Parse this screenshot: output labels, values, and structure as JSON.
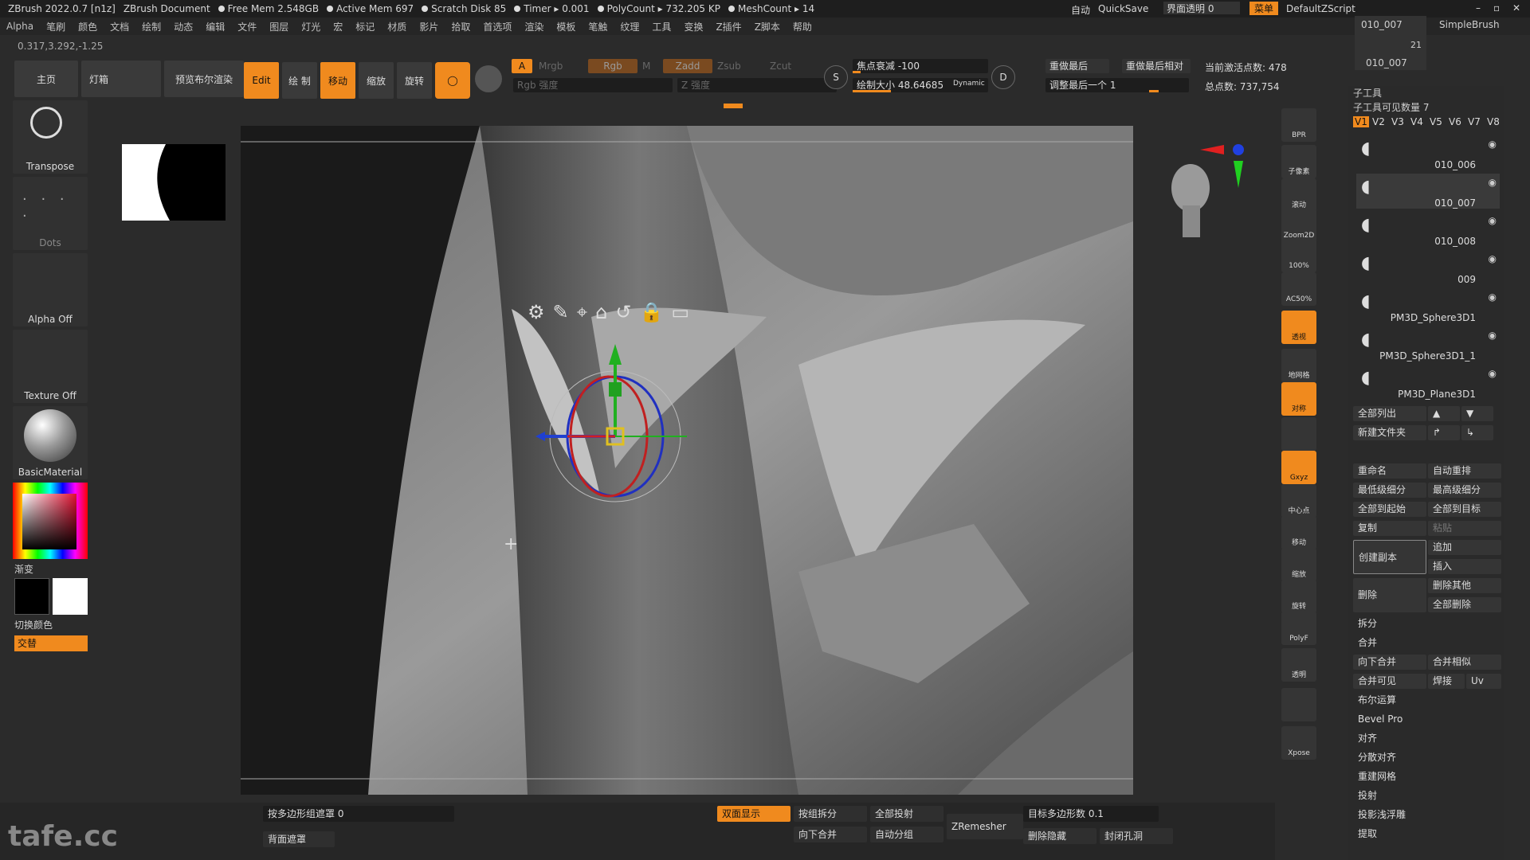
{
  "titlebar": {
    "app": "ZBrush 2022.0.7 [n1z]",
    "document": "ZBrush Document",
    "free_mem": "Free Mem 2.548GB",
    "active_mem": "Active Mem 697",
    "scratch_disk": "Scratch Disk 85",
    "timer": "Timer ▸ 0.001",
    "polycount": "PolyCount ▸ 732.205 KP",
    "meshcount": "MeshCount ▸ 14",
    "auto": "自动",
    "quicksave": "QuickSave",
    "ui_transparency": "界面透明 0",
    "menu_label": "菜单",
    "script": "DefaultZScript"
  },
  "menubar": [
    "Alpha",
    "笔刷",
    "颜色",
    "文档",
    "绘制",
    "动态",
    "编辑",
    "文件",
    "图层",
    "灯光",
    "宏",
    "标记",
    "材质",
    "影片",
    "拾取",
    "首选项",
    "渲染",
    "模板",
    "笔触",
    "纹理",
    "工具",
    "变换",
    "Z插件",
    "Z脚本",
    "帮助"
  ],
  "coords": "0.317,3.292,-1.25",
  "toolbar": {
    "home": "主页",
    "lightbox": "灯箱",
    "preview_bool": "预览布尔渲染",
    "edit": "Edit",
    "draw": "绘 制",
    "move": "移动",
    "scale": "缩放",
    "rotate": "旋转",
    "a_label": "A",
    "mrgb": "Mrgb",
    "rgb": "Rgb",
    "m": "M",
    "zadd": "Zadd",
    "zsub": "Zsub",
    "zcut": "Zcut",
    "rgb_intensity": "Rgb 强度",
    "z_intensity": "Z 强度",
    "focal_shift": "焦点衰减 -100",
    "draw_size": "绘制大小 48.64685",
    "dynamic": "Dynamic",
    "replay_last": "重做最后",
    "replay_last_rel": "重做最后相对",
    "adjust_last": "调整最后一个 1",
    "active_points": "当前激活点数: 478",
    "total_points": "总点数: 737,754"
  },
  "leftpanel": {
    "transpose": "Transpose",
    "dots": "Dots",
    "alpha_off": "Alpha Off",
    "texture_off": "Texture Off",
    "material": "BasicMaterial",
    "gradient": "渐变",
    "switch_color": "切换颜色",
    "alternate": "交替"
  },
  "vstrip": [
    "BPR",
    "子像素",
    "滚动",
    "Zoom2D",
    "100%",
    "AC50%",
    "透视",
    "地网格",
    "对称",
    "",
    "Gxyz",
    "中心点",
    "移动",
    "缩放",
    "旋转",
    "PolyF",
    "透明",
    "",
    "Xpose"
  ],
  "rpanel": {
    "top_items": [
      "010_007",
      "010_007",
      "SimpleBrush"
    ],
    "brush_count": "21",
    "subtool_header": "子工具",
    "visible_count": "子工具可见数量 7",
    "versions": [
      "V1",
      "V2",
      "V3",
      "V4",
      "V5",
      "V6",
      "V7",
      "V8"
    ],
    "subtools": [
      "010_006",
      "010_007",
      "010_008",
      "009",
      "PM3D_Sphere3D1",
      "PM3D_Sphere3D1_1",
      "PM3D_Plane3D1"
    ],
    "list_all": "全部列出",
    "new_folder": "新建文件夹",
    "rename": "重命名",
    "auto_reorder": "自动重排",
    "lowest_res": "最低级细分",
    "highest_res": "最高级细分",
    "all_to_start": "全部到起始",
    "all_to_target": "全部到目标",
    "copy": "复制",
    "paste": "粘贴",
    "duplicate": "创建副本",
    "append": "追加",
    "insert": "插入",
    "delete": "删除",
    "delete_other": "删除其他",
    "delete_all": "全部删除",
    "split": "拆分",
    "merge": "合并",
    "merge_down": "向下合并",
    "merge_similar": "合并相似",
    "merge_visible": "合并可见",
    "weld": "焊接",
    "uv": "Uv",
    "boolean": "布尔运算",
    "bevel_pro": "Bevel Pro",
    "align": "对齐",
    "distribute": "分散对齐",
    "remesh": "重建网格",
    "project": "投射",
    "project_bas": "投影浅浮雕",
    "extract": "提取"
  },
  "bottom": {
    "polygroup_mask": "按多边形组遮罩 0",
    "backface_mask": "背面遮罩",
    "double_sided": "双面显示",
    "group_split": "按组拆分",
    "project_all": "全部投射",
    "zremesher": "ZRemesher",
    "target_polycount": "目标多边形数 0.1",
    "merge_down": "向下合并",
    "auto_groups": "自动分组",
    "delete_hidden": "删除隐藏",
    "close_holes": "封闭孔洞"
  },
  "watermark": "tafe.cc",
  "colors": {
    "accent": "#f08a1e",
    "bg": "#2b2b2b"
  }
}
